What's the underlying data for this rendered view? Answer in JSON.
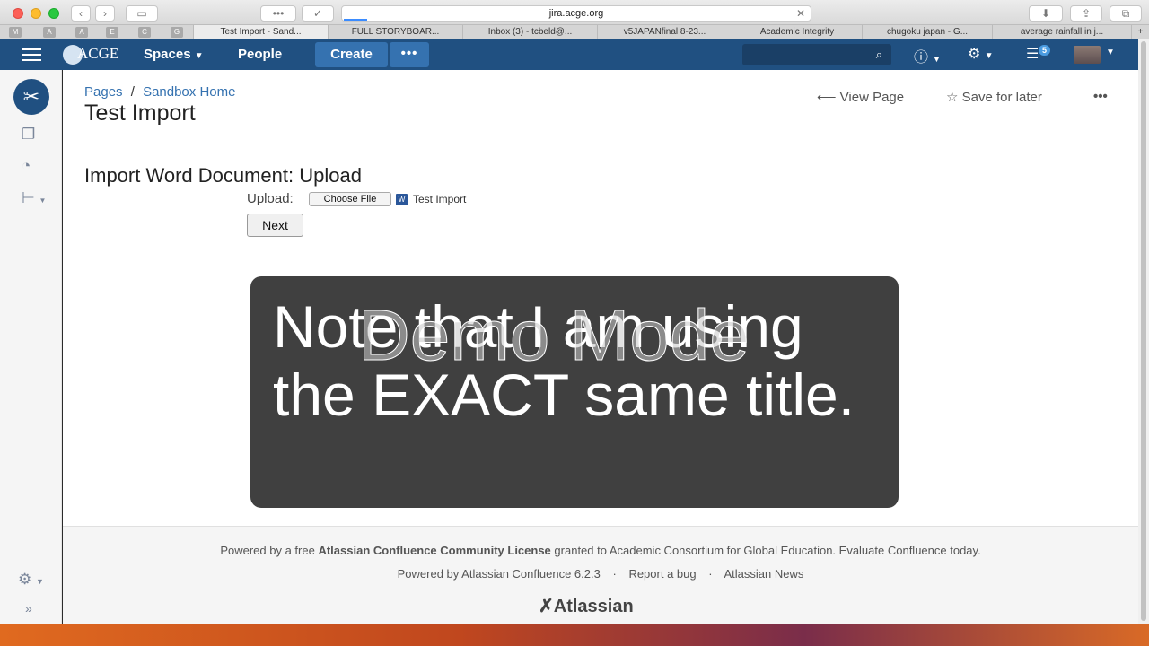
{
  "browser": {
    "url": "jira.acge.org",
    "pinned_tabs": [
      "M",
      "A",
      "A",
      "E",
      "C",
      "G"
    ],
    "tabs": [
      "Test Import - Sand...",
      "FULL STORYBOAR...",
      "Inbox (3) - tcbeld@...",
      "v5JAPANfinal 8-23...",
      "Academic Integrity",
      "chugoku japan - G...",
      "average rainfall in j..."
    ]
  },
  "header": {
    "logo_text": "ACGE",
    "spaces": "Spaces",
    "people": "People",
    "create": "Create",
    "more": "•••",
    "notifications_count": "5"
  },
  "breadcrumbs": {
    "pages": "Pages",
    "separator": "/",
    "space": "Sandbox Home"
  },
  "page": {
    "title": "Test Import",
    "view_page": "View Page",
    "save_for_later": "Save for later",
    "more": "•••"
  },
  "import_form": {
    "heading": "Import Word Document: Upload",
    "upload_label": "Upload:",
    "choose_file": "Choose File",
    "file_name": "Test Import",
    "next": "Next"
  },
  "overlay": {
    "caption": "Note that I am using the EXACT same title.",
    "watermark": "Demo Mode"
  },
  "footer": {
    "line1_prefix": "Powered by a free",
    "line1_bold": "Atlassian Confluence Community License",
    "line1_suffix": "granted to Academic Consortium for Global Education. Evaluate Confluence today.",
    "powered_by": "Powered by Atlassian Confluence 6.2.3",
    "report_bug": "Report a bug",
    "news": "Atlassian News",
    "brand": "Atlassian"
  },
  "colors": {
    "header_bg": "#205081",
    "create_btn": "#3572b0",
    "link": "#3572b0"
  }
}
